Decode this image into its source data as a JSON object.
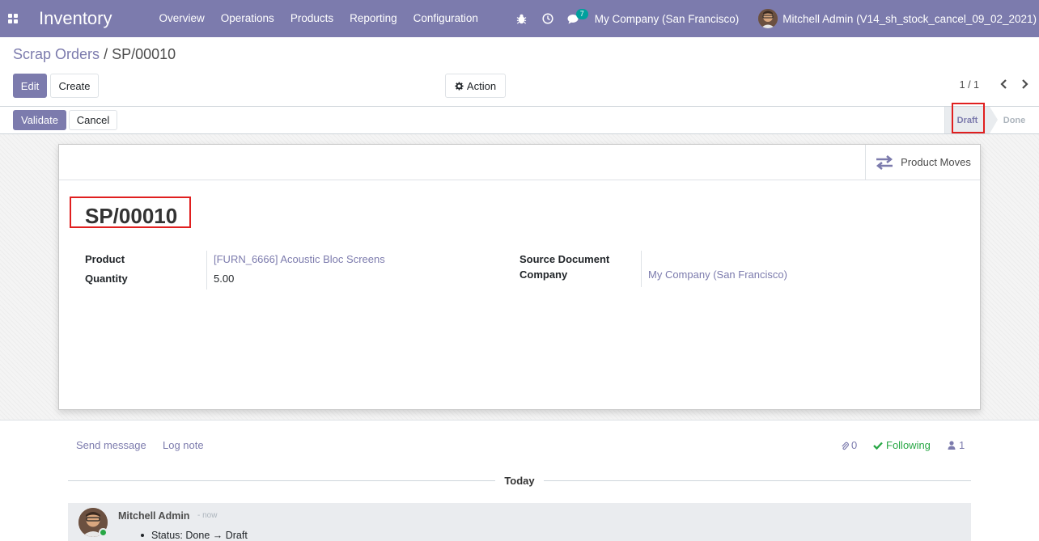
{
  "navbar": {
    "app_name": "Inventory",
    "menu": [
      "Overview",
      "Operations",
      "Products",
      "Reporting",
      "Configuration"
    ],
    "message_count": "7",
    "company": "My Company (San Francisco)",
    "user": "Mitchell Admin (V14_sh_stock_cancel_09_02_2021)",
    "icons": [
      "apps-icon",
      "bug-icon",
      "clock-icon",
      "chat-icon"
    ]
  },
  "breadcrumb": {
    "parent": "Scrap Orders",
    "separator": "/",
    "current": "SP/00010"
  },
  "control": {
    "edit": "Edit",
    "create": "Create",
    "action": "Action",
    "pager": "1 / 1"
  },
  "statusbar": {
    "validate": "Validate",
    "cancel": "Cancel",
    "stages": [
      "Draft",
      "Done"
    ],
    "current_stage": "Draft"
  },
  "sheet": {
    "smart_button": "Product Moves",
    "title": "SP/00010",
    "fields": {
      "product_label": "Product",
      "product_value": "[FURN_6666] Acoustic Bloc Screens",
      "quantity_label": "Quantity",
      "quantity_value": "5.00",
      "source_doc_label": "Source Document",
      "company_label": "Company",
      "company_value": "My Company (San Francisco)"
    }
  },
  "chatter": {
    "send_message": "Send message",
    "log_note": "Log note",
    "attachments": "0",
    "following": "Following",
    "followers": "1",
    "date_separator": "Today",
    "message": {
      "author": "Mitchell Admin",
      "time": "- now",
      "status_text": "Status: Done → Draft"
    }
  },
  "colors": {
    "brand": "#7c7bad",
    "highlight": "#e01f1f",
    "following": "#28a745"
  }
}
